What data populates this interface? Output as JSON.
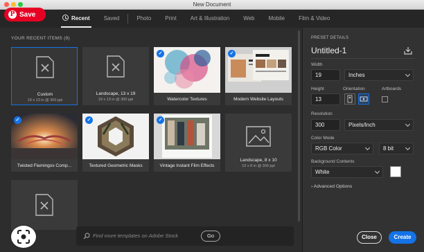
{
  "window": {
    "title": "New Document"
  },
  "overlay": {
    "save_label": "Save",
    "pin_glyph": "P"
  },
  "tabs": [
    {
      "label": "Recent",
      "active": true
    },
    {
      "label": "Saved"
    },
    {
      "label": "Photo"
    },
    {
      "label": "Print"
    },
    {
      "label": "Art & Illustration"
    },
    {
      "label": "Web"
    },
    {
      "label": "Mobile"
    },
    {
      "label": "Film & Video"
    }
  ],
  "recent": {
    "header": "YOUR RECENT ITEMS  (9)",
    "items": [
      {
        "name": "Custom",
        "dim": "19 x 13 in @ 300 ppi"
      },
      {
        "name": "Landscape, 13 x 19",
        "dim": "19 x 13 in @ 300 ppi"
      },
      {
        "name": "Watercolor Textures",
        "dim": ""
      },
      {
        "name": "Modern Website Layouts",
        "dim": ""
      },
      {
        "name": "Twisted Flamingos Comp...",
        "dim": ""
      },
      {
        "name": "Textured Geometric Masks",
        "dim": ""
      },
      {
        "name": "Vintage Instant Film Effects",
        "dim": ""
      },
      {
        "name": "Landscape, 8 x 10",
        "dim": "10 x 8 in @ 300 ppi"
      }
    ]
  },
  "search": {
    "placeholder": "Find more templates on Adobe Stock",
    "go_label": "Go"
  },
  "preset": {
    "section_label": "PRESET DETAILS",
    "name": "Untitled-1",
    "width_label": "Width",
    "width_value": "19",
    "width_unit": "Inches",
    "height_label": "Height",
    "height_value": "13",
    "orientation_label": "Orientation",
    "artboards_label": "Artboards",
    "resolution_label": "Resolution",
    "resolution_value": "300",
    "resolution_unit": "Pixels/Inch",
    "color_mode_label": "Color Mode",
    "color_mode_value": "RGB Color",
    "bit_depth": "8 bit",
    "bg_label": "Background Contents",
    "bg_value": "White",
    "bg_swatch": "#ffffff",
    "advanced_label": "Advanced Options"
  },
  "buttons": {
    "close": "Close",
    "create": "Create"
  },
  "colors": {
    "accent": "#1473e6",
    "pin_red": "#e60023"
  }
}
